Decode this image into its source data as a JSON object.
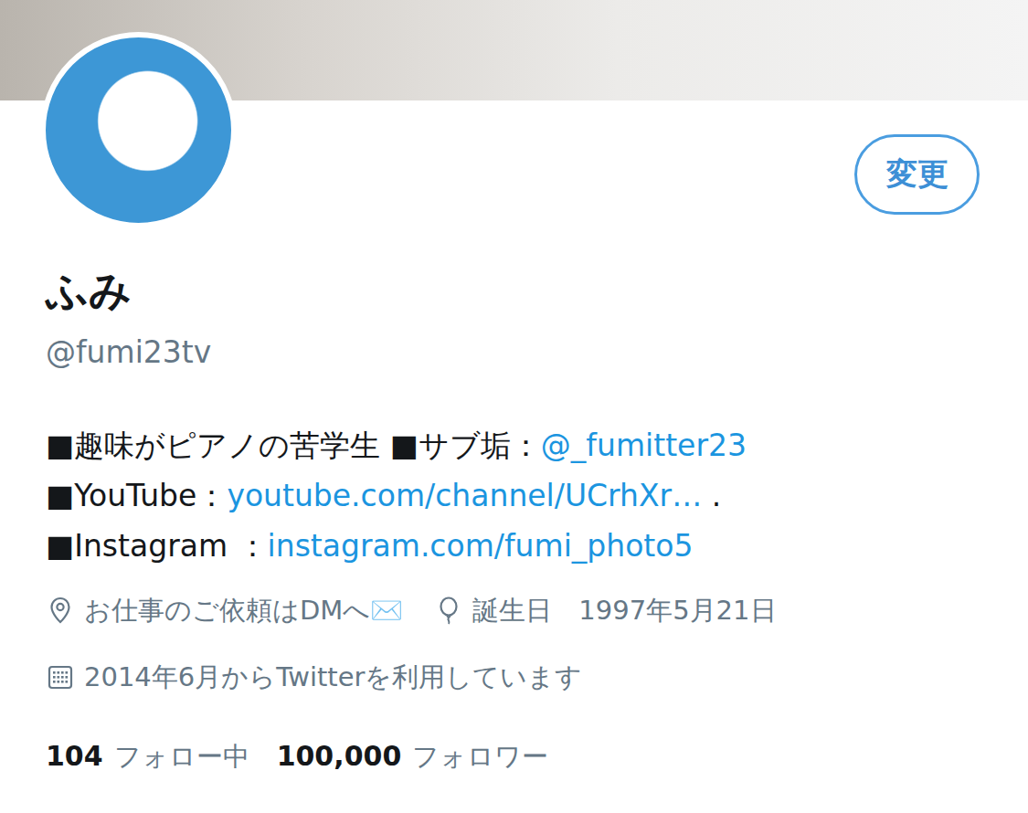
{
  "profile": {
    "name": "ふみ",
    "handle": "@fumi23tv",
    "edit_button": "変更"
  },
  "bio": {
    "lines": [
      [
        {
          "kind": "text",
          "text": "■趣味がピアノの苦学生 ■サブ垢："
        },
        {
          "kind": "link",
          "text": "@_fumitter23"
        }
      ],
      [
        {
          "kind": "text",
          "text": "■YouTube："
        },
        {
          "kind": "link",
          "text": "youtube.com/channel/UCrhXr…"
        },
        {
          "kind": "text",
          "text": " ."
        }
      ],
      [
        {
          "kind": "text",
          "text": "■Instagram ："
        },
        {
          "kind": "link",
          "text": "instagram.com/fumi_photo5"
        }
      ]
    ]
  },
  "meta_rows": [
    [
      {
        "kind": "location",
        "text": "お仕事のご依頼はDMへ✉️"
      },
      {
        "kind": "birthday",
        "text": "誕生日　1997年5月21日"
      }
    ],
    [
      {
        "kind": "joined",
        "text": "2014年6月からTwitterを利用しています"
      }
    ]
  ],
  "stats": [
    {
      "count": "104",
      "label": "フォロー中"
    },
    {
      "count": "100,000",
      "label": "フォロワー"
    }
  ]
}
